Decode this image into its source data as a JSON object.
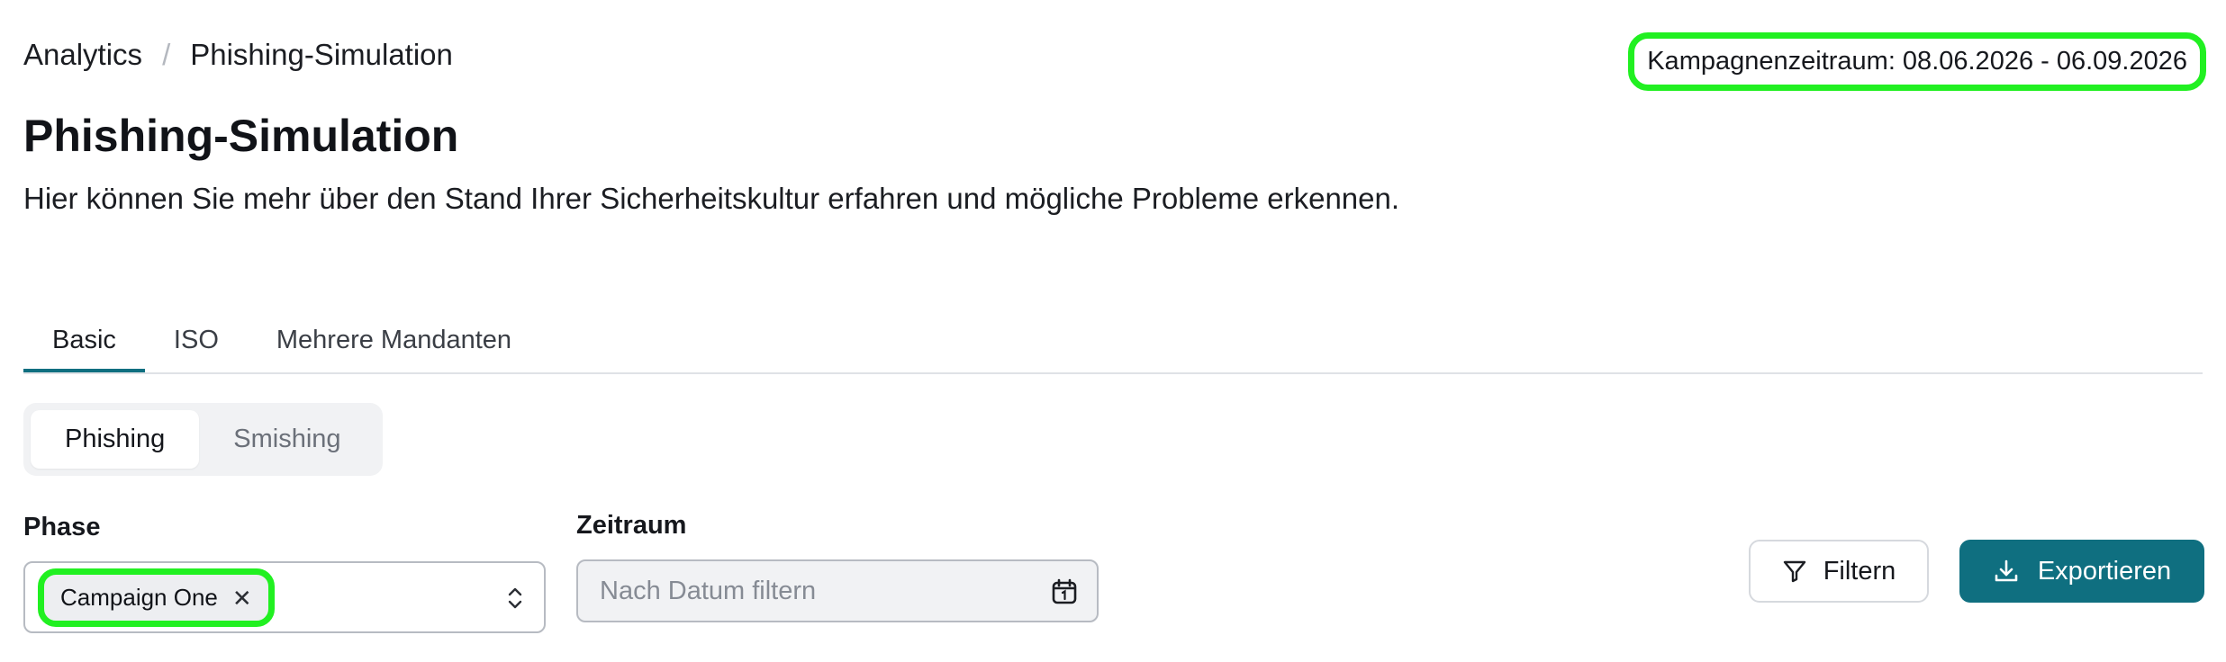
{
  "breadcrumb": {
    "items": [
      "Analytics",
      "Phishing-Simulation"
    ],
    "separator": "/"
  },
  "campaign_period": "Kampagnenzeitraum: 08.06.2026 - 06.09.2026",
  "page": {
    "title": "Phishing-Simulation",
    "subtitle": "Hier können Sie mehr über den Stand Ihrer Sicherheitskultur erfahren und mögliche Probleme erkennen."
  },
  "tabs": [
    {
      "label": "Basic",
      "active": true
    },
    {
      "label": "ISO",
      "active": false
    },
    {
      "label": "Mehrere Mandanten",
      "active": false
    }
  ],
  "channel_toggle": [
    {
      "label": "Phishing",
      "active": true
    },
    {
      "label": "Smishing",
      "active": false
    }
  ],
  "phase": {
    "label": "Phase",
    "selected_chip": "Campaign One",
    "chip_remove_icon": "close-icon",
    "toggle_icon": "chevron-up-down-icon"
  },
  "date_range": {
    "label": "Zeitraum",
    "placeholder": "Nach Datum filtern",
    "icon": "calendar-icon"
  },
  "actions": {
    "filter_label": "Filtern",
    "filter_icon": "filter-icon",
    "export_label": "Exportieren",
    "export_icon": "download-icon"
  },
  "colors": {
    "accent": "#0f6f80",
    "highlight": "#21f021",
    "text": "#16181d"
  }
}
